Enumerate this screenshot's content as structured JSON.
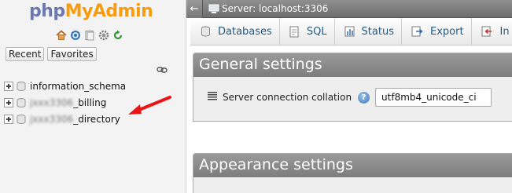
{
  "logo": {
    "php": "php",
    "my": "My",
    "admin": "Admin"
  },
  "quick_icons": [
    "home-icon",
    "logout-icon",
    "docs-icon",
    "settings-gear-icon",
    "reload-icon"
  ],
  "nav_tabs": {
    "recent": "Recent",
    "favorites": "Favorites"
  },
  "databases": [
    {
      "name": "information_schema",
      "blurred_prefix": ""
    },
    {
      "blurred_prefix": "jxxx3306",
      "name": "_billing"
    },
    {
      "blurred_prefix": "jxxx3306",
      "name": "_directory"
    }
  ],
  "annotation": {
    "color": "#e81416"
  },
  "topbar": {
    "server": "Server: localhost:3306"
  },
  "menu": {
    "databases": "Databases",
    "sql": "SQL",
    "status": "Status",
    "export": "Export",
    "next_partial": "In"
  },
  "general_settings": {
    "legend": "General settings",
    "collation_label": "Server connection collation",
    "collation_value": "utf8mb4_unicode_ci"
  },
  "appearance_settings": {
    "legend": "Appearance settings"
  },
  "colors": {
    "link": "#235a81",
    "logo_blue": "#6c78af",
    "logo_orange": "#f89c0e"
  }
}
